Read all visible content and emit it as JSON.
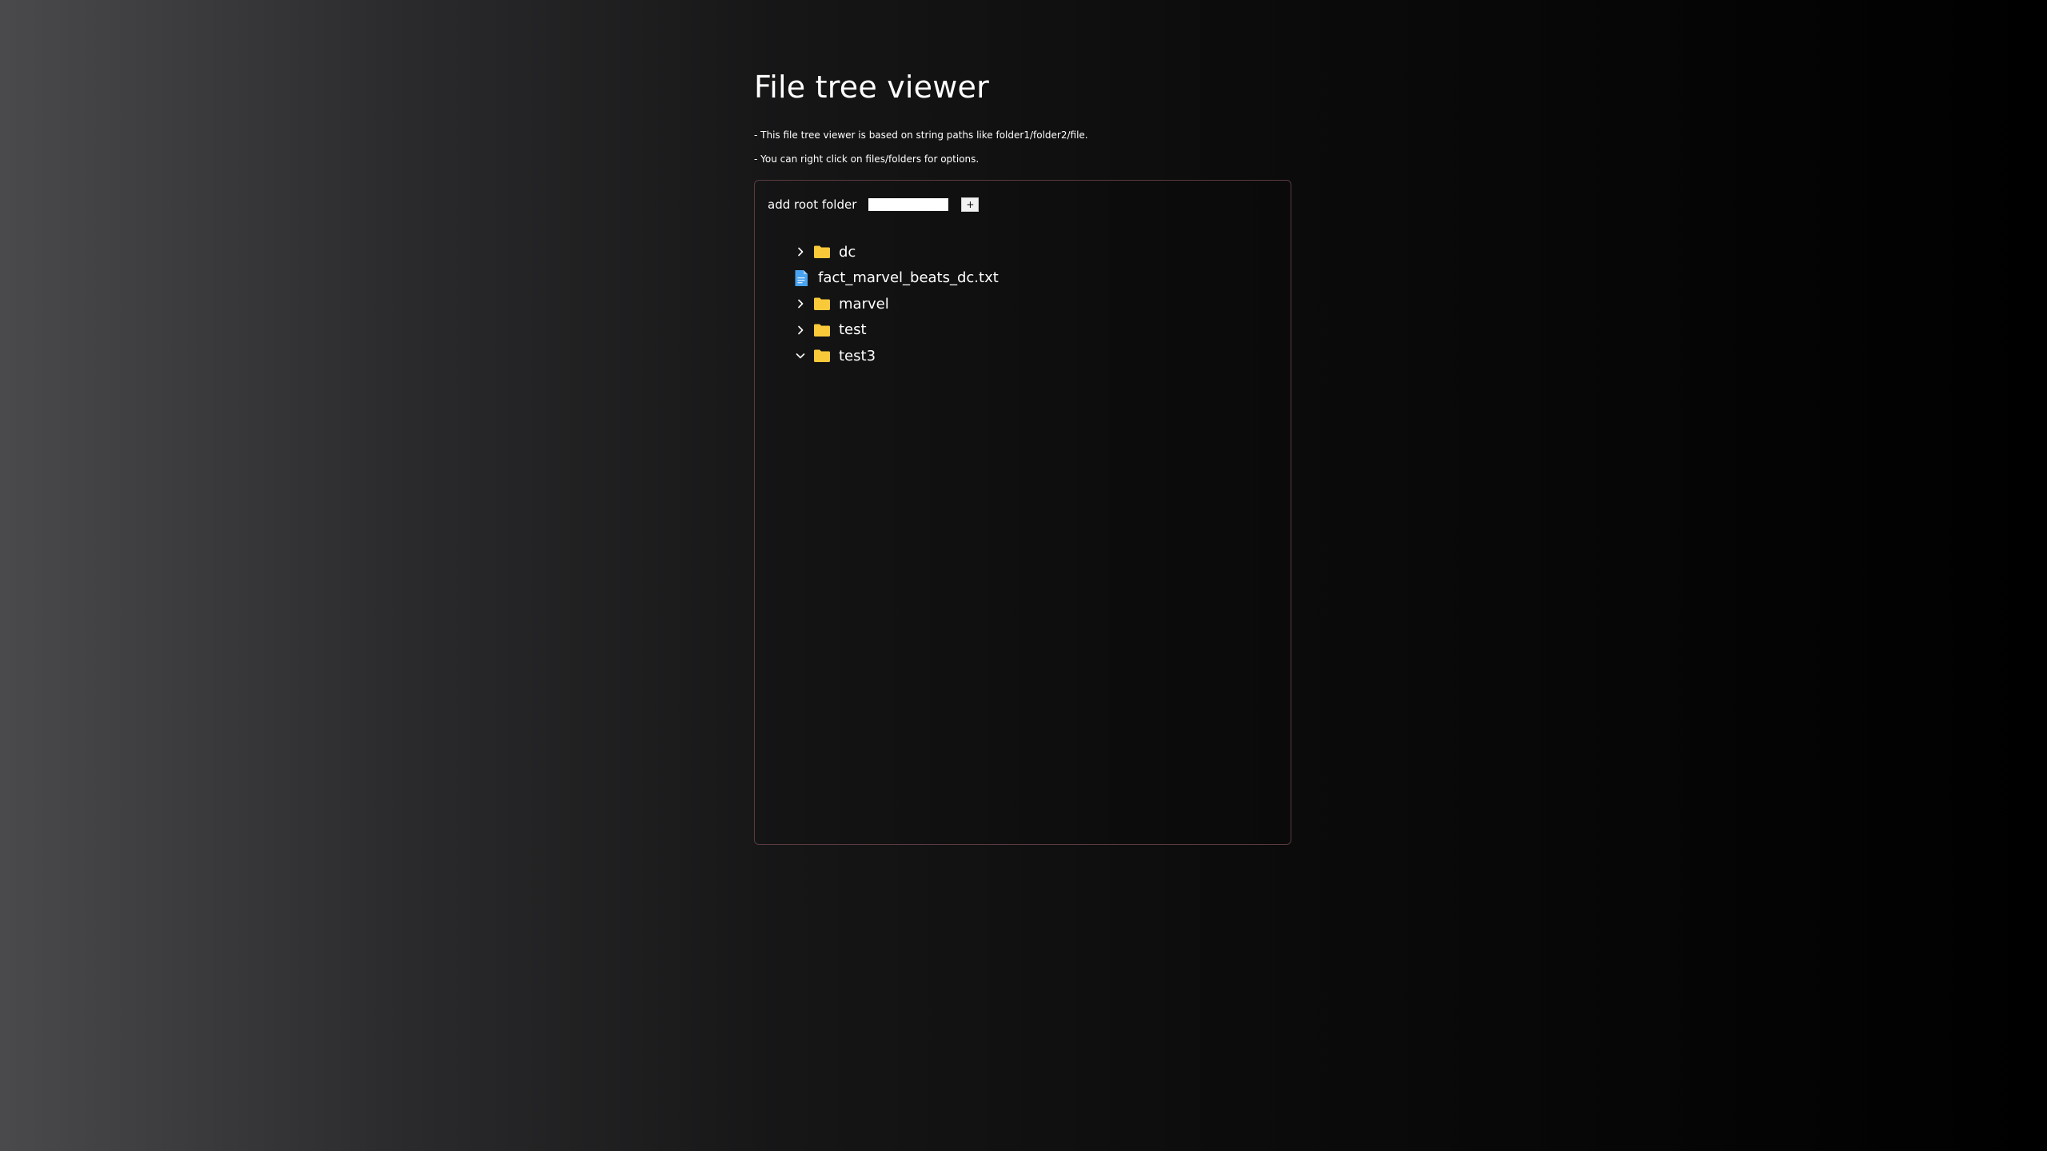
{
  "page": {
    "title": "File tree viewer",
    "notes": [
      "- This file tree viewer is based on string paths like folder1/folder2/file.",
      "- You can right click on files/folders for options."
    ]
  },
  "add_root": {
    "label": "add root folder",
    "input_value": "",
    "button_label": "+"
  },
  "tree": {
    "items": [
      {
        "label": "dc",
        "type": "folder",
        "expanded": false,
        "icon": "folder-icon"
      },
      {
        "label": "fact_marvel_beats_dc.txt",
        "type": "file",
        "icon": "file-icon"
      },
      {
        "label": "marvel",
        "type": "folder",
        "expanded": false,
        "icon": "folder-icon"
      },
      {
        "label": "test",
        "type": "folder",
        "expanded": false,
        "icon": "folder-icon"
      },
      {
        "label": "test3",
        "type": "folder",
        "expanded": true,
        "icon": "folder-icon"
      }
    ]
  },
  "colors": {
    "folder": "#f9c93a",
    "file": "#4aa3f0",
    "panel_border": "#5a3b3f"
  }
}
